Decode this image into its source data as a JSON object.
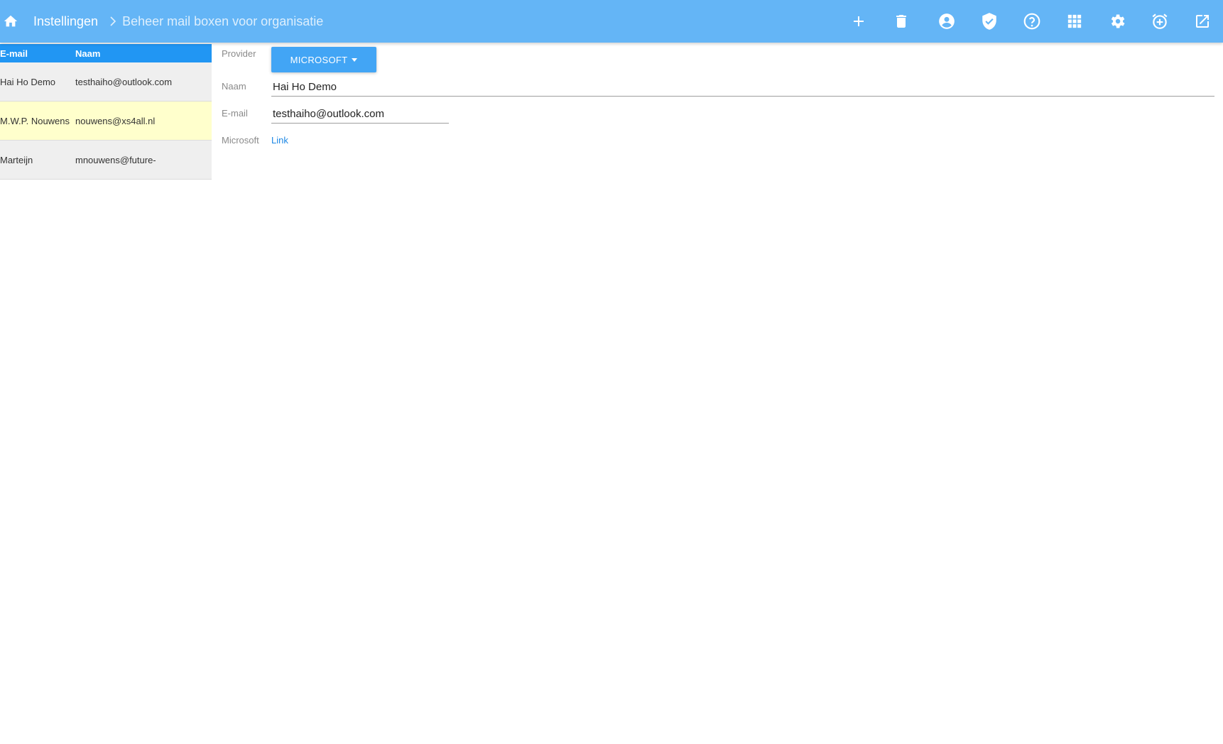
{
  "header": {
    "home_icon": "home-icon",
    "breadcrumb_root": "Instellingen",
    "breadcrumb_current": "Beheer mail boxen voor organisatie",
    "toolbar": [
      {
        "name": "add-icon"
      },
      {
        "name": "delete-icon"
      },
      {
        "name": "account-icon"
      },
      {
        "name": "shield-check-icon"
      },
      {
        "name": "help-icon"
      },
      {
        "name": "apps-grid-icon"
      },
      {
        "name": "gear-icon"
      },
      {
        "name": "alarm-add-icon"
      },
      {
        "name": "open-external-icon"
      }
    ]
  },
  "list": {
    "columns": [
      "E-mail",
      "Naam"
    ],
    "rows": [
      {
        "c1": "Hai Ho Demo",
        "c2": "testhaiho@outlook.com",
        "selected": false
      },
      {
        "c1": "M.W.P. Nouwens",
        "c2": "nouwens@xs4all.nl",
        "selected": true
      },
      {
        "c1": "Marteijn",
        "c2": "mnouwens@future-",
        "selected": false
      }
    ]
  },
  "form": {
    "provider_label": "Provider",
    "provider_value": "MICROSOFT",
    "naam_label": "Naam",
    "naam_value": "Hai Ho Demo",
    "email_label": "E-mail",
    "email_value": "testhaiho@outlook.com",
    "microsoft_label": "Microsoft",
    "microsoft_link": "Link"
  },
  "colors": {
    "header": "#64b5f6",
    "list_header": "#2196f3",
    "selected_row": "#ffffcc",
    "button": "#42a5f5",
    "link": "#1e88e5"
  }
}
